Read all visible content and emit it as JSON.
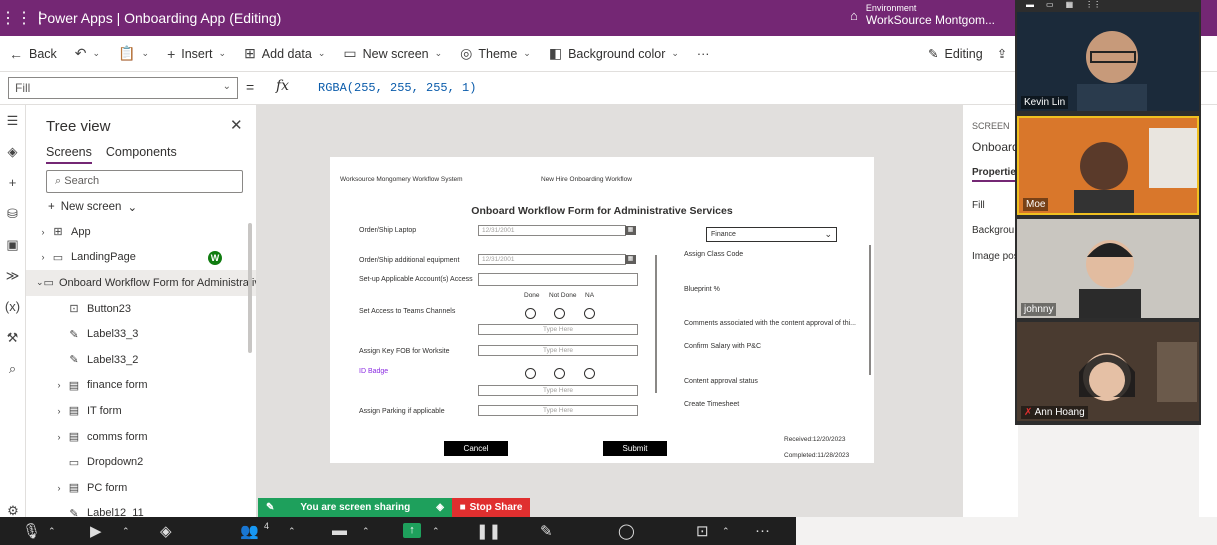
{
  "titlebar": {
    "app_title": "Power Apps  |  Onboarding App (Editing)",
    "environment_label": "Environment",
    "environment_name": "WorkSource Montgom..."
  },
  "commands": {
    "back": "Back",
    "insert": "Insert",
    "add_data": "Add data",
    "new_screen": "New screen",
    "theme": "Theme",
    "background_color": "Background color",
    "more": "···",
    "editing": "Editing"
  },
  "formula": {
    "property": "Fill",
    "equals": "=",
    "fx": "fx",
    "expression": "RGBA(255, 255, 255, 1)"
  },
  "tree": {
    "title": "Tree view",
    "tab_screens": "Screens",
    "tab_components": "Components",
    "search_placeholder": "Search",
    "new_screen": "New screen",
    "items": [
      {
        "label": "App"
      },
      {
        "label": "LandingPage",
        "badge": "W"
      },
      {
        "label": "Onboard Workflow Form for Administrativ"
      },
      {
        "label": "Button23"
      },
      {
        "label": "Label33_3"
      },
      {
        "label": "Label33_2"
      },
      {
        "label": "finance form"
      },
      {
        "label": "IT form"
      },
      {
        "label": "comms form"
      },
      {
        "label": "Dropdown2"
      },
      {
        "label": "PC form"
      },
      {
        "label": "Label12_11"
      }
    ]
  },
  "form": {
    "header_left": "Worksource Mongomery Workflow System",
    "header_center": "New Hire Onboarding Workflow",
    "title": "Onboard Workflow Form for Administrative Services",
    "fields": {
      "laptop": "Order/Ship Laptop",
      "equipment": "Order/Ship additional equipment",
      "accounts": "Set-up Applicable Account(s) Access",
      "teams": "Set Access to Teams Channels",
      "fob": "Assign Key FOB for Worksite",
      "badge": "ID Badge",
      "parking": "Assign Parking if applicable"
    },
    "date_laptop": "12/31/2001",
    "date_equipment": "12/31/2001",
    "calendar_icon": "▦",
    "col_done": "Done",
    "col_not_done": "Not Done",
    "col_na": "NA",
    "type_here": "Type Here",
    "dropdown_value": "Finance",
    "right_labels": {
      "class_code": "Assign Class Code",
      "blueprint": "Blueprint %",
      "comments": "Comments associated with the content approval of thi...",
      "salary": "Confirm Salary with P&C",
      "approval": "Content approval status",
      "timesheet": "Create Timesheet"
    },
    "cancel": "Cancel",
    "submit": "Submit",
    "received": "Received:12/20/2023",
    "completed": "Completed:11/28/2023"
  },
  "properties": {
    "section": "SCREEN",
    "name": "Onboard",
    "tab": "Properties",
    "fill": "Fill",
    "background": "Backgrou",
    "image_position": "Image pos"
  },
  "participants": [
    {
      "name": "Kevin Lin",
      "bg": "#1b2a3a"
    },
    {
      "name": "Moe",
      "bg": "#d9772b"
    },
    {
      "name": "johnny",
      "bg": "#c9c6c0"
    },
    {
      "name": "Ann Hoang",
      "bg": "#4a3b30"
    }
  ],
  "sharing": {
    "status": "You are screen sharing",
    "stop": "Stop Share"
  },
  "zoom": {
    "participants_count": "4"
  }
}
